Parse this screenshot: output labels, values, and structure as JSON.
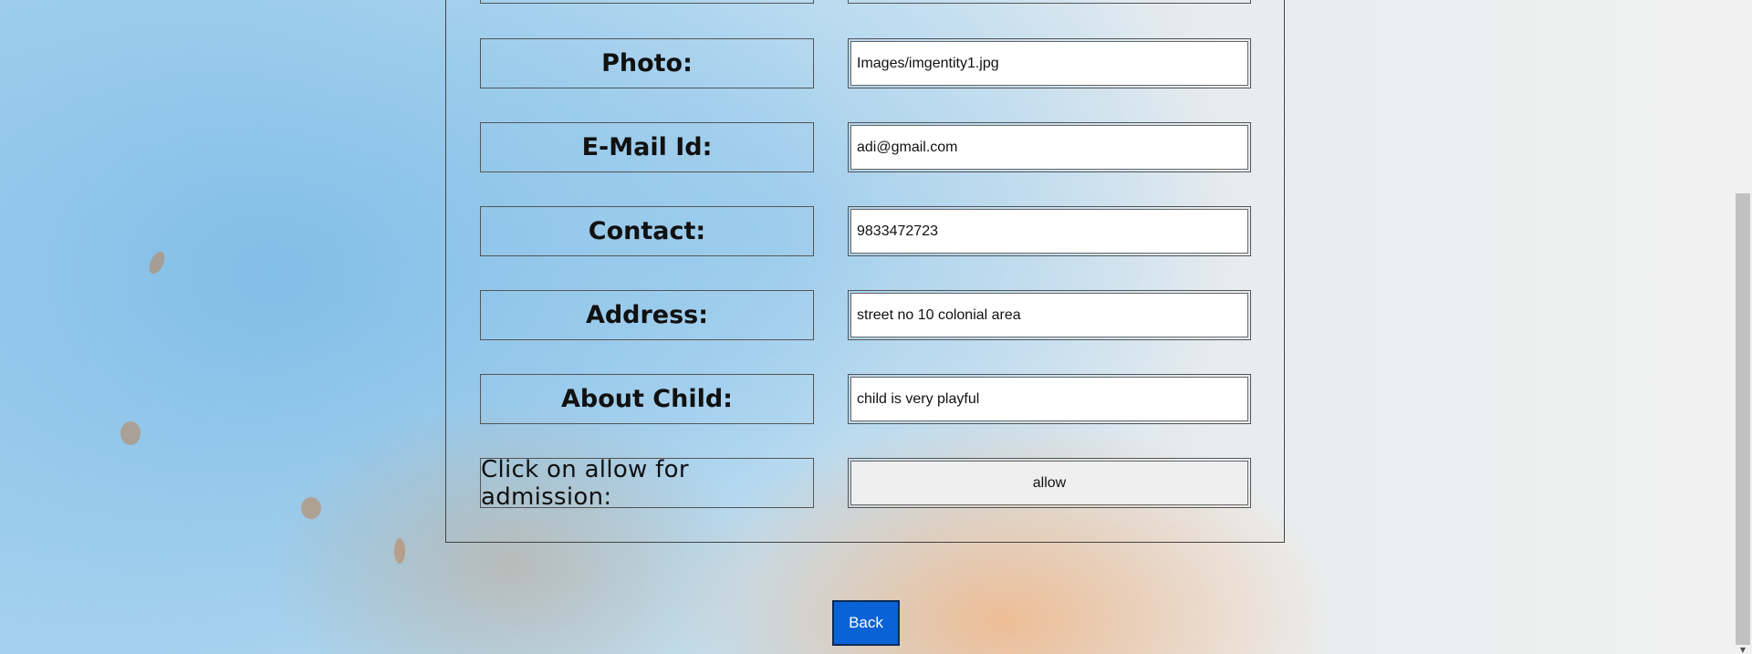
{
  "form": {
    "rows": [
      {
        "label": "Photo:",
        "value": "Images/imgentity1.jpg",
        "top": 0
      },
      {
        "label": "E-Mail Id:",
        "value": "adi@gmail.com",
        "top": 0
      },
      {
        "label": "Contact:",
        "value": "9833472723",
        "top": 0
      },
      {
        "label": "Address:",
        "value": "street no 10 colonial area",
        "top": 0
      },
      {
        "label": "About Child:",
        "value": "child is very playful",
        "top": 0
      }
    ],
    "admission": {
      "label": "Click on allow for admission:",
      "button_label": "allow"
    }
  },
  "back_button": {
    "label": "Back"
  },
  "colors": {
    "back_button_bg": "#0a63d6",
    "field_bg": "#ffffff",
    "allow_button_bg": "#efefef"
  }
}
